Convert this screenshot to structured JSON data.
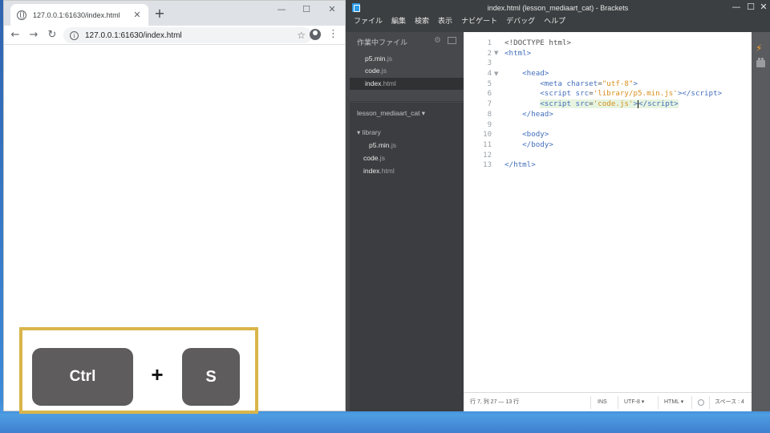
{
  "chrome": {
    "tab_title": "127.0.0.1:61630/index.html",
    "tab_close": "✕",
    "newtab": "+",
    "minimize": "—",
    "maximize": "☐",
    "close": "✕",
    "url": "127.0.0.1:61630/index.html",
    "back": "←",
    "forward": "→",
    "reload": "↻",
    "star": "☆",
    "menu": "⋮",
    "info": "i"
  },
  "overlay": {
    "key1": "Ctrl",
    "plus": "+",
    "key2": "S",
    "border_color": "#d9b54a"
  },
  "brackets": {
    "title": "index.html (lesson_mediaart_cat) - Brackets",
    "minimize": "—",
    "maximize": "☐",
    "close": "✕",
    "menu": [
      "ファイル",
      "編集",
      "検索",
      "表示",
      "ナビゲート",
      "デバッグ",
      "ヘルプ"
    ],
    "working_files_header": "作業中ファイル",
    "working_files": [
      {
        "name": "p5.min",
        "ext": ".js"
      },
      {
        "name": "code",
        "ext": ".js"
      },
      {
        "name": "index",
        "ext": ".html"
      }
    ],
    "project_title": "lesson_mediaart_cat ▾",
    "tree": {
      "folder": "▾ library",
      "folder_file": {
        "name": "p5.min",
        "ext": ".js"
      },
      "files": [
        {
          "name": "code",
          "ext": ".js"
        },
        {
          "name": "index",
          "ext": ".html"
        }
      ]
    },
    "line_numbers": [
      "1",
      "2",
      "3",
      "4",
      "5",
      "6",
      "7",
      "8",
      "9",
      "10",
      "11",
      "12",
      "13"
    ],
    "status": {
      "position": "行 7, 列 27 — 13 行",
      "mode": "INS",
      "encoding": "UTF-8 ▾",
      "language": "HTML ▾",
      "spaces": "スペース : 4"
    },
    "accent_color": "#446fbd",
    "string_color": "#d88f1c"
  }
}
